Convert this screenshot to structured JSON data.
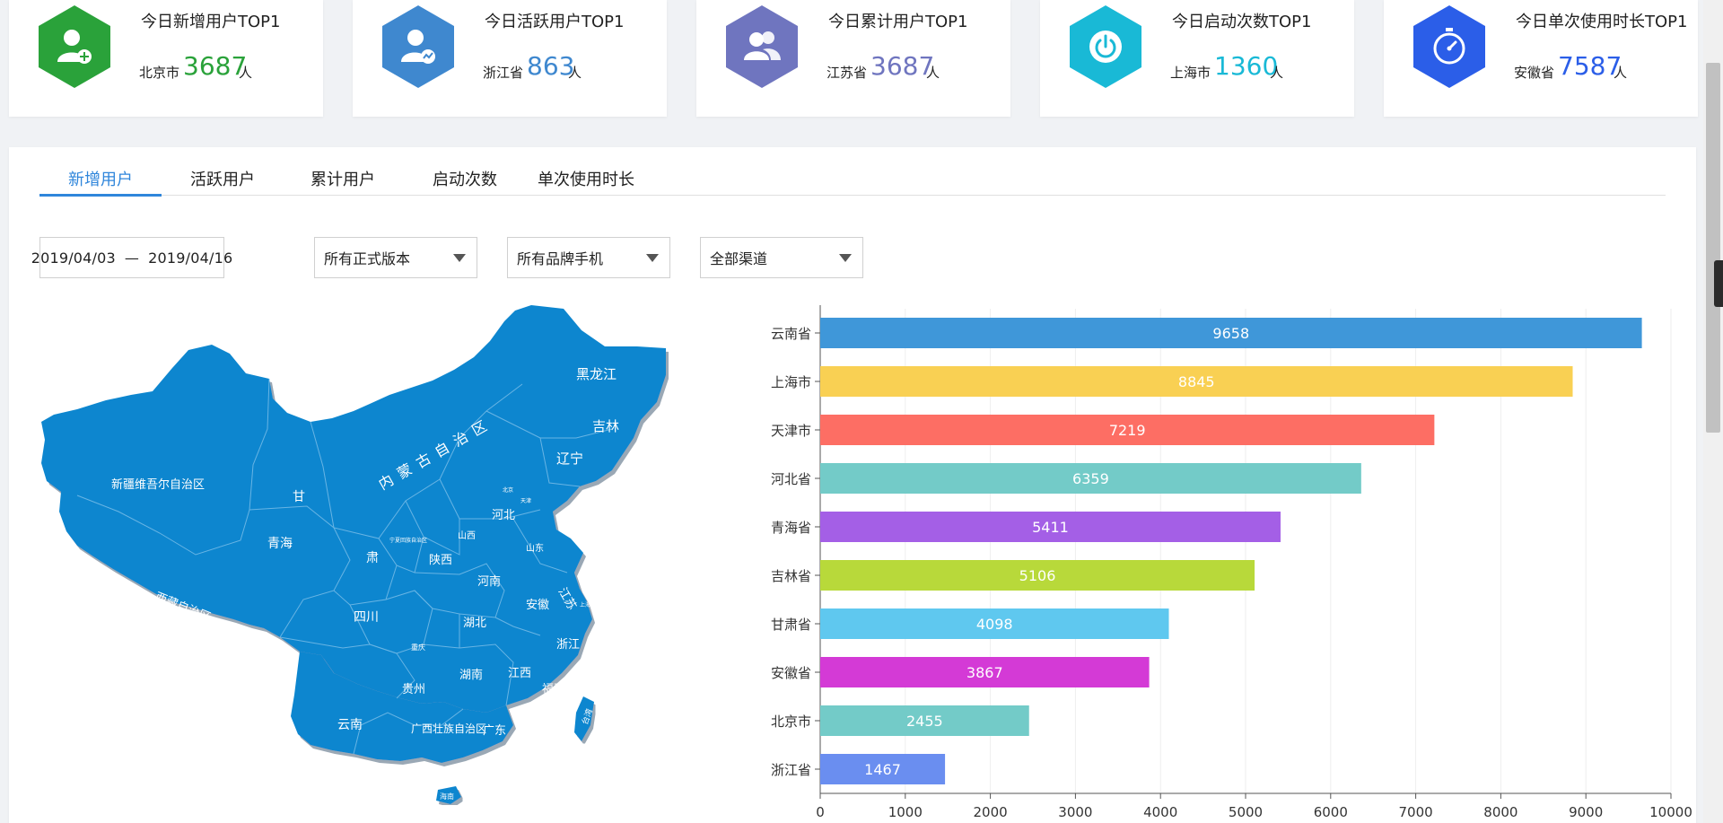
{
  "cards": [
    {
      "title": "今日新增用户TOP1",
      "region": "北京市",
      "value": "3687",
      "unit": "人",
      "color": "#2aa23a",
      "value_color": "#2aa23a",
      "icon": "add-user-icon"
    },
    {
      "title": "今日活跃用户TOP1",
      "region": "浙江省",
      "value": "863",
      "unit": "人",
      "color": "#3f88cf",
      "value_color": "#3f88cf",
      "icon": "active-user-icon"
    },
    {
      "title": "今日累计用户TOP1",
      "region": "江苏省",
      "value": "3687",
      "unit": "人",
      "color": "#6f75bf",
      "value_color": "#6f75bf",
      "icon": "users-icon"
    },
    {
      "title": "今日启动次数TOP1",
      "region": "上海市",
      "value": "1360",
      "unit": "人",
      "color": "#19b9d6",
      "value_color": "#19b9d6",
      "icon": "power-icon"
    },
    {
      "title": "今日单次使用时长TOP1",
      "region": "安徽省",
      "value": "7587",
      "unit": "人",
      "color": "#2b5ee8",
      "value_color": "#2b5ee8",
      "icon": "stopwatch-icon"
    }
  ],
  "tabs": [
    {
      "label": "新增用户",
      "active": true
    },
    {
      "label": "活跃用户",
      "active": false
    },
    {
      "label": "累计用户",
      "active": false
    },
    {
      "label": "启动次数",
      "active": false
    },
    {
      "label": "单次使用时长",
      "active": false
    }
  ],
  "filters": {
    "date_start": "2019/04/03",
    "date_sep": "—",
    "date_end": "2019/04/16",
    "version": "所有正式版本",
    "brand": "所有品牌手机",
    "channel": "全部渠道"
  },
  "map": {
    "fill": "#0a86cf",
    "labels": [
      "黑龙江",
      "吉林",
      "辽宁",
      "内蒙古自治区",
      "新疆维吾尔自治区",
      "甘",
      "肃",
      "青海",
      "西藏自治区",
      "四川",
      "陕西",
      "山西",
      "河北",
      "北京",
      "天津",
      "山东",
      "河南",
      "江苏",
      "安徽",
      "上海",
      "湖北",
      "浙江",
      "重庆",
      "湖南",
      "江西",
      "福建",
      "贵州",
      "云南",
      "广西壮族自治区",
      "广东",
      "台湾",
      "海南",
      "宁夏回族自治区"
    ]
  },
  "chart_data": {
    "type": "bar",
    "orientation": "horizontal",
    "categories": [
      "云南省",
      "上海市",
      "天津市",
      "河北省",
      "青海省",
      "吉林省",
      "甘肃省",
      "安徽省",
      "北京市",
      "浙江省"
    ],
    "values": [
      9658,
      8845,
      7219,
      6359,
      5411,
      5106,
      4098,
      3867,
      2455,
      1467
    ],
    "colors": [
      "#3f97d9",
      "#f9d053",
      "#fd6e64",
      "#73cbc8",
      "#a45fe6",
      "#b8d93a",
      "#5fc8ef",
      "#d43ad6",
      "#73cbc8",
      "#6a8ef0"
    ],
    "xlim": [
      0,
      10000
    ],
    "xticks": [
      "0",
      "1000",
      "2000",
      "3000",
      "4000",
      "5000",
      "6000",
      "7000",
      "8000",
      "9000",
      "10000"
    ],
    "grid": true
  }
}
